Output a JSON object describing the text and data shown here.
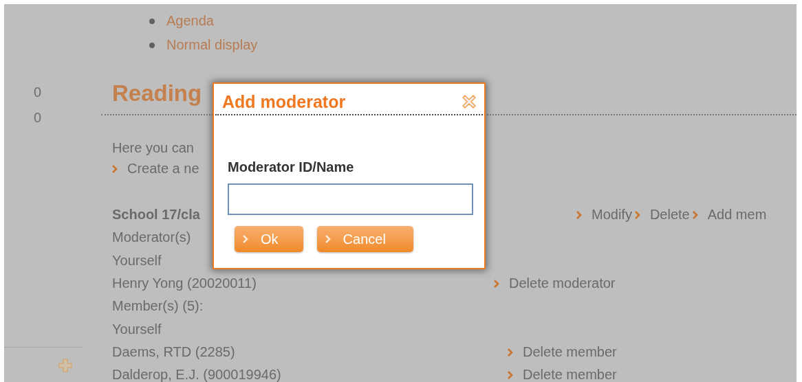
{
  "nav_items": [
    "Agenda",
    "Normal display"
  ],
  "sidebar_counts": [
    "0",
    "0"
  ],
  "heading": "Reading",
  "intro": "Here you can",
  "create_link": "Create a ne",
  "rows": [
    {
      "kind": "group",
      "text": "School 17/cla",
      "actions": [
        "Modify",
        "Delete",
        "Add mem"
      ]
    },
    {
      "kind": "text",
      "text": "Moderator(s)"
    },
    {
      "kind": "text",
      "text": "Yourself"
    },
    {
      "kind": "moderator",
      "text": "Henry Yong (20020011)",
      "actions": [
        "Delete moderator"
      ]
    },
    {
      "kind": "text",
      "text": "Member(s) (5):"
    },
    {
      "kind": "text",
      "text": "Yourself"
    },
    {
      "kind": "member",
      "text": "Daems, RTD (2285)",
      "actions": [
        "Delete member"
      ]
    },
    {
      "kind": "member",
      "text": "Dalderop, E.J. (900019946)",
      "actions": [
        "Delete member"
      ]
    }
  ],
  "dialog": {
    "title": "Add moderator",
    "field_label": "Moderator ID/Name",
    "buttons": [
      "Ok",
      "Cancel"
    ]
  }
}
